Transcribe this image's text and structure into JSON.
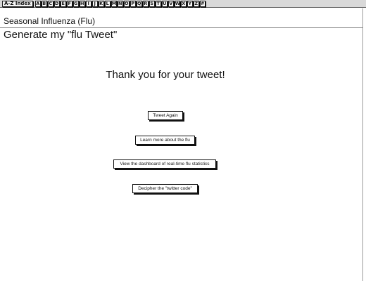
{
  "az_index": {
    "label": "A-Z Index",
    "letters": [
      "A",
      "B",
      "C",
      "D",
      "E",
      "F",
      "G",
      "H",
      "I",
      "J",
      "K",
      "L",
      "M",
      "N",
      "O",
      "P",
      "Q",
      "R",
      "S",
      "T",
      "U",
      "V",
      "W",
      "X",
      "Y",
      "Z",
      "#"
    ]
  },
  "header": {
    "site_title": "Seasonal Influenza (Flu)",
    "page_title": "Generate my \"flu Tweet\""
  },
  "main": {
    "message": "Thank you for your tweet!",
    "buttons": {
      "tweet_again": "Tweet Again",
      "learn_more": "Learn more about the flu",
      "dashboard": "View the dashboard of real-time flu statistics",
      "decipher": "Decipher the \"twitter code\""
    }
  }
}
